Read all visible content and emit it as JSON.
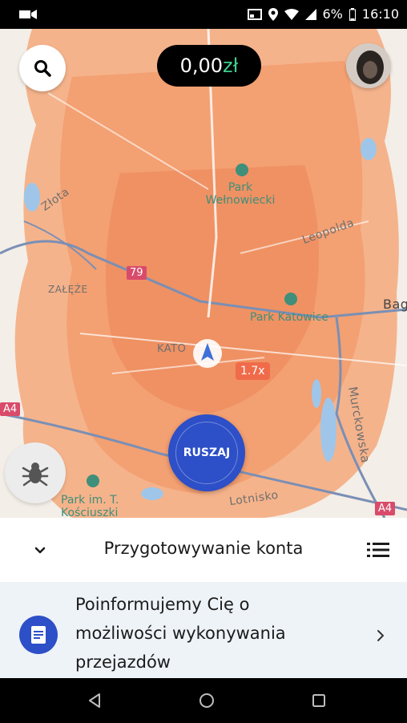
{
  "status_bar": {
    "battery": "6%",
    "time": "16:10"
  },
  "map": {
    "labels": {
      "zlota": "Złota",
      "leopolda": "Leopolda",
      "zaleze": "ZAŁĘŻE",
      "kato": "KATO",
      "bag": "Bag",
      "murckowska": "Murckowska",
      "lotnisko": "Lotnisko",
      "a4_left": "A4",
      "a4_right": "A4"
    },
    "parks": {
      "welnowiecki_line1": "Park",
      "welnowiecki_line2": "Wełnowiecki",
      "katowice": "Park Katowice",
      "kosciuszki_line1": "Park im. T.",
      "kosciuszki_line2": "Kościuszki"
    },
    "road_79": "79",
    "surge": "1.7x"
  },
  "top": {
    "earnings_amount": "0,00",
    "earnings_currency": "zł"
  },
  "go_button": "RUSZAJ",
  "panel": {
    "title": "Przygotowywanie konta"
  },
  "notice": {
    "line1": "Poinformujemy Cię o",
    "line2": "możliwości wykonywania",
    "line3": "przejazdów"
  },
  "colors": {
    "primary": "#2d4fc7",
    "earnings_currency": "#3ecf8e",
    "surge": "#f06b4a",
    "road_badge": "#d94b6b"
  }
}
